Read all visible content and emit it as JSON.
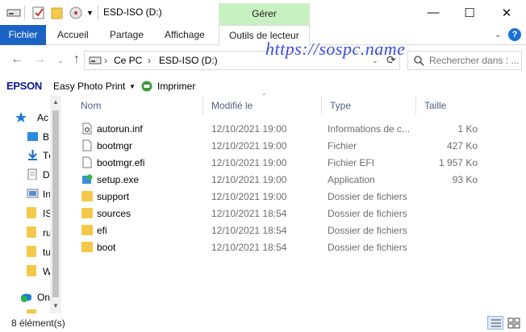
{
  "window": {
    "title": "ESD-ISO (D:)",
    "contextual_tab": "Gérer",
    "controls": {
      "minimize": "—",
      "maximize": "☐",
      "close": "✕"
    }
  },
  "ribbon": {
    "tabs": [
      "Fichier",
      "Accueil",
      "Partage",
      "Affichage",
      "Outils de lecteur"
    ],
    "active_tab": "Outils de lecteur",
    "help": "?"
  },
  "address": {
    "root": "Ce PC",
    "current": "ESD-ISO (D:)",
    "separator": "›",
    "search_placeholder": "Rechercher dans : ..."
  },
  "watermark": "https://sospc.name",
  "epson_toolbar": {
    "logo": "EPSON",
    "items": [
      "Easy Photo Print",
      "Imprimer"
    ]
  },
  "nav_pane": {
    "items": [
      {
        "label": "Ac",
        "icon": "star-icon"
      },
      {
        "label": "B",
        "icon": "desktop-folder-icon"
      },
      {
        "label": "Té",
        "icon": "download-icon"
      },
      {
        "label": "D",
        "icon": "document-icon"
      },
      {
        "label": "In",
        "icon": "pictures-icon"
      },
      {
        "label": "IS",
        "icon": "folder-icon"
      },
      {
        "label": "ru",
        "icon": "folder-icon"
      },
      {
        "label": "tu",
        "icon": "folder-icon"
      },
      {
        "label": "W",
        "icon": "folder-icon"
      },
      {
        "label": "On",
        "icon": "onedrive-icon"
      }
    ]
  },
  "columns": [
    "Nom",
    "Modifié le",
    "Type",
    "Taille"
  ],
  "files": [
    {
      "name": "autorun.inf",
      "modified": "12/10/2021 19:00",
      "type": "Informations de c...",
      "size": "1 Ko",
      "icon": "settings-file-icon"
    },
    {
      "name": "bootmgr",
      "modified": "12/10/2021 19:00",
      "type": "Fichier",
      "size": "427 Ko",
      "icon": "file-icon"
    },
    {
      "name": "bootmgr.efi",
      "modified": "12/10/2021 19:00",
      "type": "Fichier EFI",
      "size": "1 957 Ko",
      "icon": "file-icon"
    },
    {
      "name": "setup.exe",
      "modified": "12/10/2021 19:00",
      "type": "Application",
      "size": "93 Ko",
      "icon": "setup-icon"
    },
    {
      "name": "support",
      "modified": "12/10/2021 19:00",
      "type": "Dossier de fichiers",
      "size": "",
      "icon": "folder-icon"
    },
    {
      "name": "sources",
      "modified": "12/10/2021 18:54",
      "type": "Dossier de fichiers",
      "size": "",
      "icon": "folder-icon"
    },
    {
      "name": "efi",
      "modified": "12/10/2021 18:54",
      "type": "Dossier de fichiers",
      "size": "",
      "icon": "folder-icon"
    },
    {
      "name": "boot",
      "modified": "12/10/2021 18:54",
      "type": "Dossier de fichiers",
      "size": "",
      "icon": "folder-icon"
    }
  ],
  "status": {
    "count": "8 élément(s)"
  },
  "colors": {
    "file_tab": "#1a63c4",
    "contextual_tab": "#c8f0c0",
    "header_text": "#4d6082",
    "folder": "#f4c94a",
    "watermark": "#3a4fd6"
  }
}
